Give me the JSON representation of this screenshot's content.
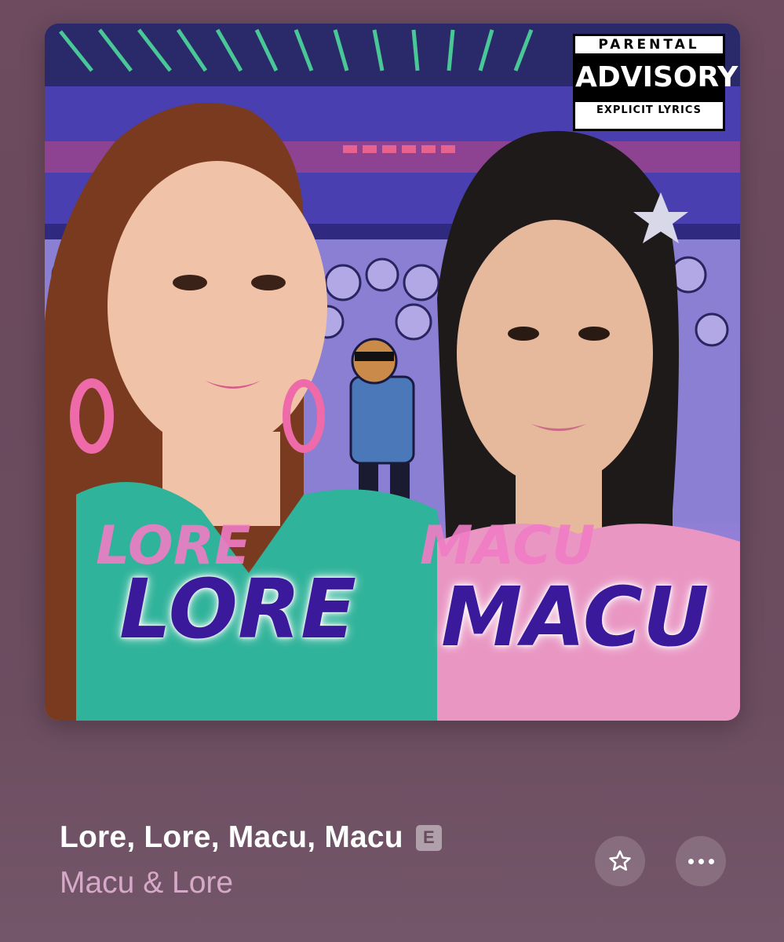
{
  "artwork": {
    "advisory": {
      "line1": "PARENTAL",
      "line2": "ADVISORY",
      "line3": "EXPLICIT LYRICS"
    },
    "name_left_ghost": "LORE",
    "name_left": "LORE",
    "name_right_ghost": "MACU",
    "name_right": "MACU"
  },
  "track": {
    "title": "Lore, Lore, Macu, Macu",
    "explicit_badge": "E",
    "artist": "Macu & Lore"
  },
  "controls": {
    "favorite_icon": "star-icon",
    "more_icon": "ellipsis-icon"
  },
  "colors": {
    "background": "#6c4c5f",
    "title": "#ffffff",
    "artist": "#d7a9c8",
    "artwork_text": "#3a1a9a",
    "artwork_text_ghost": "#f07cc6"
  }
}
